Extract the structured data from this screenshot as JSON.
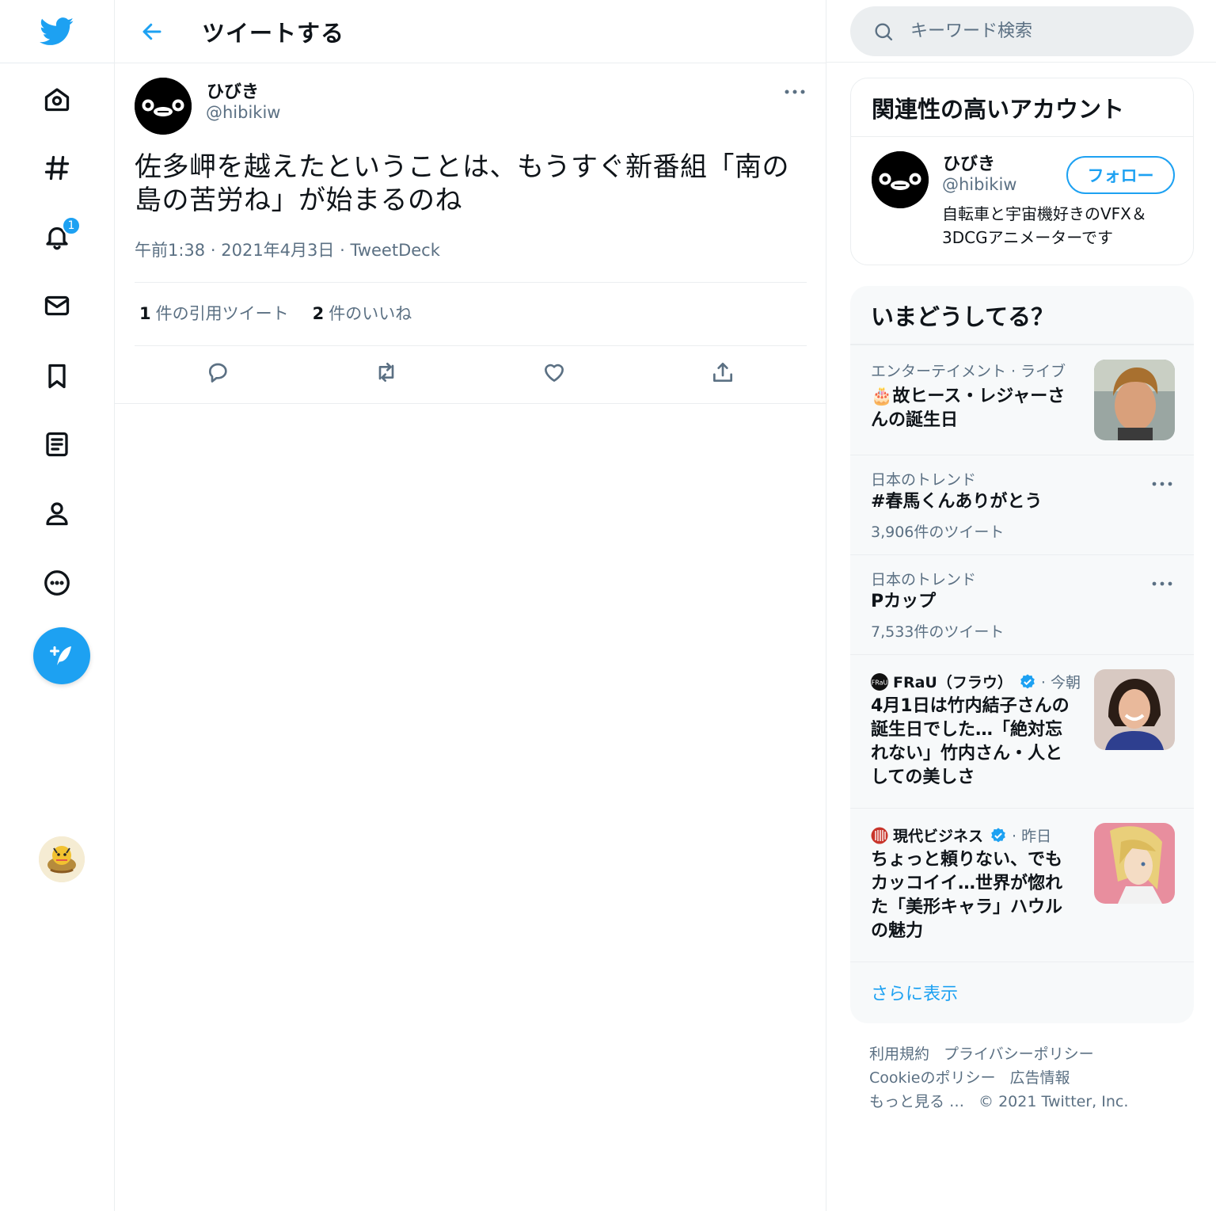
{
  "nav": {
    "notification_count": "1",
    "icons": [
      "twitter-bird-icon",
      "home-icon",
      "explore-hash-icon",
      "notifications-bell-icon",
      "messages-envelope-icon",
      "bookmarks-icon",
      "lists-icon",
      "profile-icon",
      "more-circle-icon",
      "compose-tweet-icon"
    ]
  },
  "header": {
    "title": "ツイートする"
  },
  "tweet": {
    "name": "ひびき",
    "handle": "@hibikiw",
    "text": "佐多岬を越えたということは、もうすぐ新番組「南の島の苦労ね」が始まるのね",
    "time": "午前1:38",
    "date": "2021年4月3日",
    "client": "TweetDeck",
    "sep": "·",
    "quote_count": "1",
    "quote_label": "件の引用ツイート",
    "like_count": "2",
    "like_label": "件のいいね"
  },
  "search": {
    "placeholder": "キーワード検索"
  },
  "related": {
    "title": "関連性の高いアカウント",
    "name": "ひびき",
    "handle": "@hibikiw",
    "follow_label": "フォロー",
    "bio": "自転車と宇宙機好きのVFX＆3DCGアニメーターです"
  },
  "trends": {
    "title": "いまどうしてる？",
    "items": [
      {
        "category": "エンターテイメント · ライブ",
        "title": "🎂故ヒース・レジャーさんの誕生日"
      },
      {
        "category": "日本のトレンド",
        "title": "#春馬くんありがとう",
        "count": "3,906件のツイート"
      },
      {
        "category": "日本のトレンド",
        "title": "Pカップ",
        "count": "7,533件のツイート"
      },
      {
        "source": "FRaU（フラウ）",
        "time": "· 今朝",
        "title": "4月1日は竹内結子さんの誕生日でした…「絶対忘れない」竹内さん・人としての美しさ"
      },
      {
        "source": "現代ビジネス",
        "time": "· 昨日",
        "title": "ちょっと頼りない、でもカッコイイ…世界が惚れた「美形キャラ」ハウルの魅力"
      }
    ],
    "show_more": "さらに表示"
  },
  "footer": {
    "terms": "利用規約",
    "privacy": "プライバシーポリシー",
    "cookie": "Cookieのポリシー",
    "ads": "広告情報",
    "more": "もっと見る …",
    "copyright": "© 2021 Twitter, Inc."
  },
  "colors": {
    "accent": "#1da1f2",
    "text": "#0f1419",
    "secondary": "#5b7083",
    "panel": "#f7f9fa"
  }
}
